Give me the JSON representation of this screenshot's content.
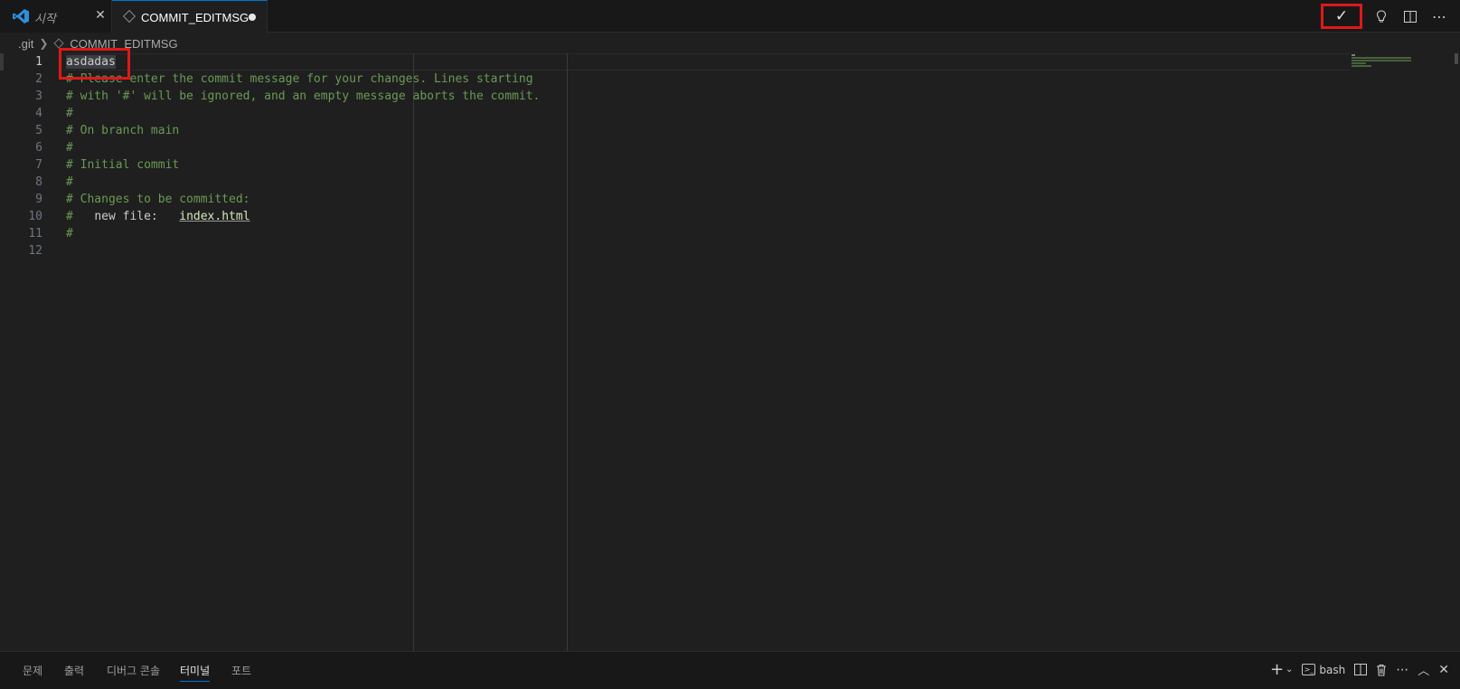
{
  "tabs": [
    {
      "label": "시작",
      "active": false
    },
    {
      "label": "COMMIT_EDITMSG",
      "active": true,
      "dirty": true
    }
  ],
  "editor_actions": {
    "commit_icon": "✓",
    "lightbulb_icon": "lightbulb-icon",
    "split_icon": "split-editor-icon",
    "more_icon": "⋯"
  },
  "breadcrumb": [
    ".git",
    "COMMIT_EDITMSG"
  ],
  "lines": [
    {
      "n": "1",
      "text": "asdadas"
    },
    {
      "n": "2",
      "text": "# Please enter the commit message for your changes. Lines starting"
    },
    {
      "n": "3",
      "text": "# with '#' will be ignored, and an empty message aborts the commit."
    },
    {
      "n": "4",
      "text": "#"
    },
    {
      "n": "5",
      "text": "# On branch main"
    },
    {
      "n": "6",
      "text": "#"
    },
    {
      "n": "7",
      "text": "# Initial commit"
    },
    {
      "n": "8",
      "text": "#"
    },
    {
      "n": "9",
      "text": "# Changes to be committed:"
    },
    {
      "n": "10",
      "prefix": "#   ",
      "label": "new file:",
      "spacer": "   ",
      "file": "index.html"
    },
    {
      "n": "11",
      "text": "#"
    },
    {
      "n": "12",
      "text": ""
    }
  ],
  "panel": {
    "tabs": [
      "문제",
      "출력",
      "디버그 콘솔",
      "터미널",
      "포트"
    ],
    "active_tab": "터미널",
    "shell": "bash",
    "icons": [
      "add-terminal-icon",
      "chevron-down-icon",
      "terminal-icon",
      "split-terminal-icon",
      "trash-icon",
      "more-icon",
      "chevron-up-icon",
      "close-icon"
    ]
  }
}
